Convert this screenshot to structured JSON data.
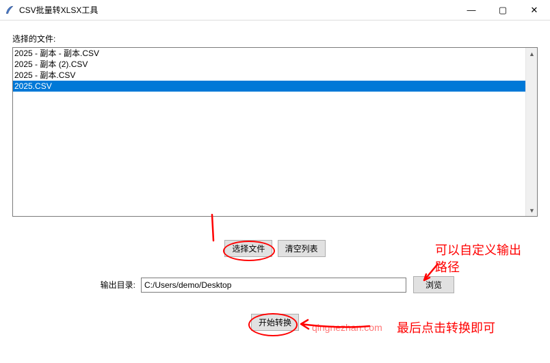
{
  "window": {
    "title": "CSV批量转XLSX工具",
    "min": "—",
    "max": "▢",
    "close": "✕"
  },
  "labels": {
    "selected_files": "选择的文件:",
    "output_dir": "输出目录:"
  },
  "files": [
    {
      "name": "2025 - 副本 - 副本.CSV",
      "selected": false
    },
    {
      "name": "2025 - 副本 (2).CSV",
      "selected": false
    },
    {
      "name": "2025 - 副本.CSV",
      "selected": false
    },
    {
      "name": "2025.CSV",
      "selected": true
    }
  ],
  "buttons": {
    "choose": "选择文件",
    "clear": "清空列表",
    "browse": "浏览",
    "start": "开始转换"
  },
  "output_path": "C:/Users/demo/Desktop",
  "scroll": {
    "up": "▲",
    "down": "▼"
  },
  "annotations": {
    "custom_path": "可以自定义输出\n路径",
    "final_click": "最后点击转换即可"
  },
  "watermark": "qingnezhan.com"
}
